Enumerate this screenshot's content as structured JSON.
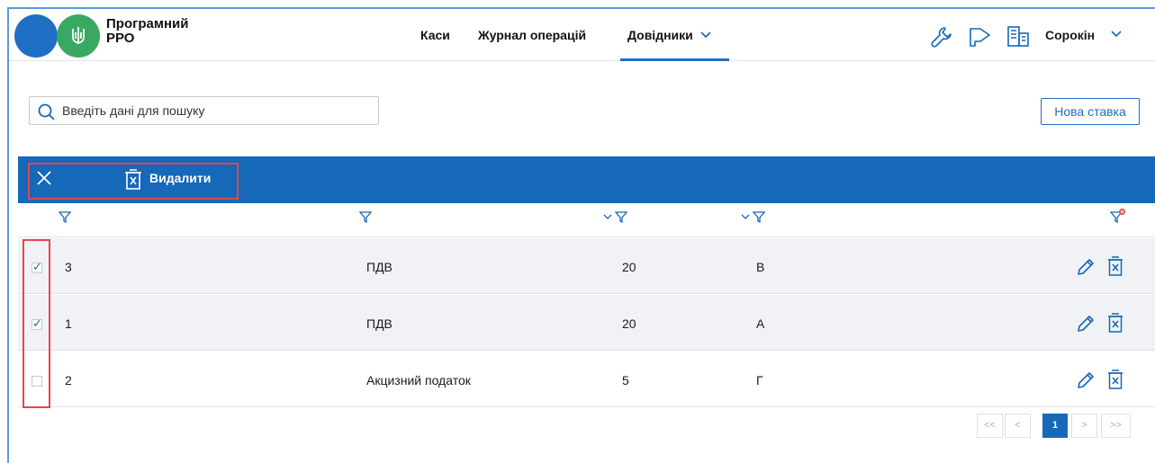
{
  "header": {
    "brand_line1": "Програмний",
    "brand_line2": "РРО",
    "nav": [
      "Каси",
      "Журнал операцій",
      "Довідники"
    ],
    "user": "Сорокін"
  },
  "search": {
    "placeholder": "Введіть дані для пошуку"
  },
  "new_button": "Нова ставка",
  "action_bar": {
    "delete_label": "Видалити"
  },
  "rows": [
    {
      "selected": true,
      "id": "3",
      "name": "ПДВ",
      "rate": "20",
      "letter": "В"
    },
    {
      "selected": true,
      "id": "1",
      "name": "ПДВ",
      "rate": "20",
      "letter": "А"
    },
    {
      "selected": false,
      "id": "2",
      "name": "Акцизний податок",
      "rate": "5",
      "letter": "Г"
    }
  ],
  "pagination": {
    "first": "<<",
    "prev": "<",
    "current": "1",
    "next": ">",
    "last": ">>"
  },
  "colors": {
    "accent": "#1668b8",
    "highlight": "#e0484e",
    "logo_green": "#39a862"
  }
}
